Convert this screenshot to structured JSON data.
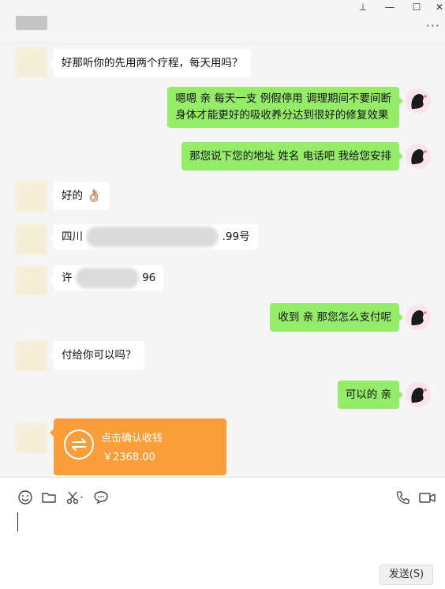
{
  "window": {
    "pin_symbol": "⊥",
    "minimize_symbol": "—",
    "maximize_symbol": "☐",
    "close_symbol": "✕",
    "more_symbol": "···"
  },
  "messages": [
    {
      "side": "left",
      "type": "text",
      "text": "好那听你的先用两个疗程，每天用吗？"
    },
    {
      "side": "right",
      "type": "text",
      "lines": [
        "嗯嗯 亲 每天一支 例假停用 调理期间不要间断",
        "身体才能更好的吸收养分达到很好的修复效果"
      ]
    },
    {
      "side": "right",
      "type": "text",
      "text": "那您说下您的地址 姓名 电话吧 我给您安排"
    },
    {
      "side": "left",
      "type": "text",
      "text": "好的",
      "emoji": "👌🏼"
    },
    {
      "side": "left",
      "type": "text",
      "prefix": "四川",
      "suffix": ".99号"
    },
    {
      "side": "left",
      "type": "text",
      "prefix": "许",
      "suffix": "96"
    },
    {
      "side": "right",
      "type": "text",
      "text": "收到 亲 那您怎么支付呢"
    },
    {
      "side": "left",
      "type": "text",
      "text": "付给你可以吗？"
    },
    {
      "side": "right",
      "type": "text",
      "text": "可以的 亲"
    },
    {
      "side": "left",
      "type": "transfer",
      "title": "点击确认收钱",
      "amount": "￥2368.00"
    }
  ],
  "composer": {
    "tools": [
      "emoji-icon",
      "folder-icon",
      "scissors-icon",
      "chat-bubble-icon",
      "phone-icon",
      "video-icon"
    ],
    "send_label": "发送(S)"
  },
  "colors": {
    "chat_background": "#f5f5f5",
    "self_bubble": "#95ec69",
    "other_bubble": "#ffffff",
    "transfer_card": "#fa9d3b"
  }
}
